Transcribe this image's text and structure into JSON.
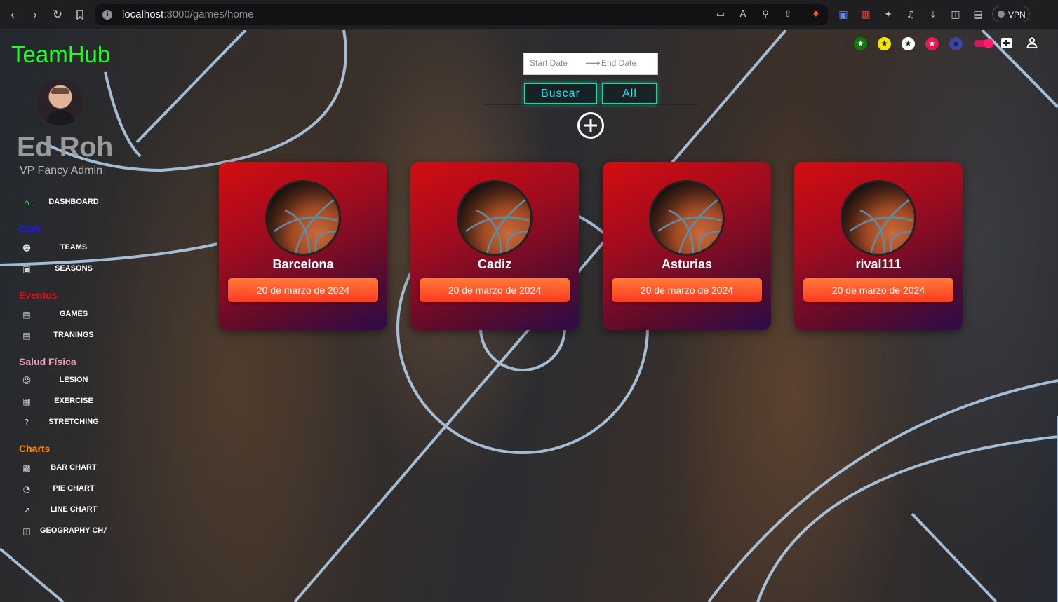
{
  "browser": {
    "url_host": "localhost",
    "url_path": ":3000/games/home",
    "vpn_label": "VPN"
  },
  "app": {
    "logo": "TeamHub",
    "user": {
      "name": "Ed Roh",
      "role": "VP Fancy Admin"
    }
  },
  "sidebar": {
    "dashboard": {
      "label": "DASHBOARD",
      "icon": "home-icon"
    },
    "sections": [
      {
        "title": "Club",
        "color": "#1a1aff",
        "items": [
          {
            "label": "TEAMS",
            "icon": "people-icon"
          },
          {
            "label": "SEASONS",
            "icon": "contact-card-icon"
          }
        ]
      },
      {
        "title": "Eventos",
        "color": "#e01010",
        "items": [
          {
            "label": "GAMES",
            "icon": "receipt-icon"
          },
          {
            "label": "TRANINGS",
            "icon": "receipt-icon"
          }
        ]
      },
      {
        "title": "Salud Física",
        "color": "#f29bb3",
        "items": [
          {
            "label": "LESION",
            "icon": "person-icon"
          },
          {
            "label": "EXERCISE",
            "icon": "calendar-icon"
          },
          {
            "label": "STRETCHING",
            "icon": "help-circle-icon"
          }
        ]
      },
      {
        "title": "Charts",
        "color": "#ff8c00",
        "items": [
          {
            "label": "BAR CHART",
            "icon": "bar-chart-icon"
          },
          {
            "label": "PIE CHART",
            "icon": "pie-chart-icon"
          },
          {
            "label": "LINE CHART",
            "icon": "line-chart-icon"
          },
          {
            "label": "GEOGRAPHY CHART",
            "icon": "map-icon"
          }
        ]
      }
    ]
  },
  "filters": {
    "start_placeholder": "Start Date",
    "end_placeholder": "End Date",
    "search_label": "Buscar",
    "all_label": "All"
  },
  "theme_stars": [
    {
      "name": "green-star",
      "color": "#0c7a0c"
    },
    {
      "name": "yellow-star",
      "color": "#f2e600"
    },
    {
      "name": "white-star",
      "color": "#ffffff"
    },
    {
      "name": "pink-star",
      "color": "#e8174f"
    },
    {
      "name": "blue-star",
      "color": "#3b45a8"
    }
  ],
  "games": [
    {
      "team": "Barcelona",
      "date": "20 de marzo de 2024"
    },
    {
      "team": "Cadiz",
      "date": "20 de marzo de 2024"
    },
    {
      "team": "Asturias",
      "date": "20 de marzo de 2024"
    },
    {
      "team": "rival111",
      "date": "20 de marzo de 2024"
    }
  ]
}
